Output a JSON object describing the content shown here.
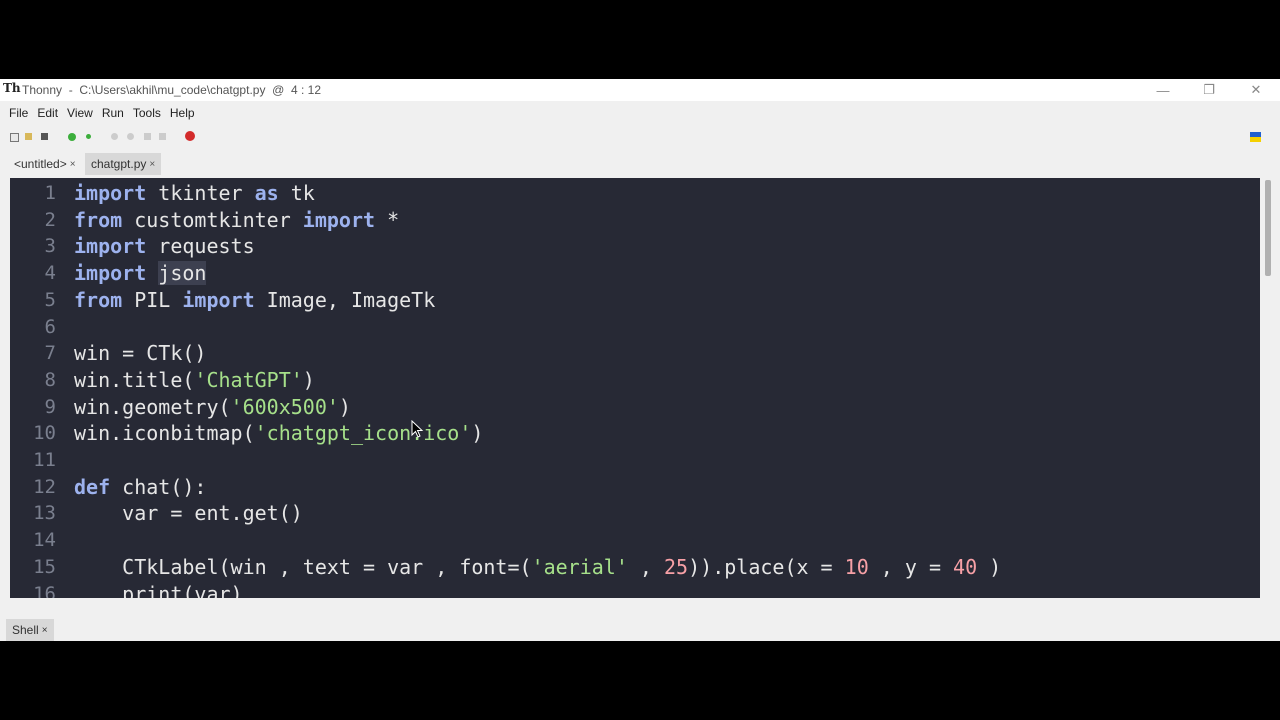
{
  "titlebar": {
    "app_name": "Thonny",
    "path": "  -  C:\\Users\\akhil\\mu_code\\chatgpt.py  @  4 : 12",
    "logo": "Th"
  },
  "menu": [
    "File",
    "Edit",
    "View",
    "Run",
    "Tools",
    "Help"
  ],
  "tabs": [
    {
      "label": "<untitled>",
      "close": "×"
    },
    {
      "label": "chatgpt.py",
      "close": "×"
    }
  ],
  "editor": {
    "lines": [
      {
        "n": "1",
        "parts": [
          [
            "kw",
            "import"
          ],
          [
            "t",
            " tkinter "
          ],
          [
            "kw",
            "as"
          ],
          [
            "t",
            " tk"
          ]
        ]
      },
      {
        "n": "2",
        "parts": [
          [
            "kw",
            "from"
          ],
          [
            "t",
            " customtkinter "
          ],
          [
            "kw",
            "import"
          ],
          [
            "t",
            " *"
          ]
        ]
      },
      {
        "n": "3",
        "parts": [
          [
            "kw",
            "import"
          ],
          [
            "t",
            " requests"
          ]
        ]
      },
      {
        "n": "4",
        "parts": [
          [
            "kw",
            "import"
          ],
          [
            "t",
            " "
          ],
          [
            "hl",
            "json"
          ]
        ]
      },
      {
        "n": "5",
        "parts": [
          [
            "kw",
            "from"
          ],
          [
            "t",
            " PIL "
          ],
          [
            "kw",
            "import"
          ],
          [
            "t",
            " Image, ImageTk"
          ]
        ]
      },
      {
        "n": "6",
        "parts": []
      },
      {
        "n": "7",
        "parts": [
          [
            "t",
            "win = CTk()"
          ]
        ]
      },
      {
        "n": "8",
        "parts": [
          [
            "t",
            "win.title("
          ],
          [
            "str",
            "'ChatGPT'"
          ],
          [
            "t",
            ")"
          ]
        ]
      },
      {
        "n": "9",
        "parts": [
          [
            "t",
            "win.geometry("
          ],
          [
            "str",
            "'600x500'"
          ],
          [
            "t",
            ")"
          ]
        ]
      },
      {
        "n": "10",
        "parts": [
          [
            "t",
            "win.iconbitmap("
          ],
          [
            "str",
            "'chatgpt_icon.ico'"
          ],
          [
            "t",
            ")"
          ]
        ]
      },
      {
        "n": "11",
        "parts": []
      },
      {
        "n": "12",
        "parts": [
          [
            "kw",
            "def"
          ],
          [
            "t",
            " chat():"
          ]
        ]
      },
      {
        "n": "13",
        "parts": [
          [
            "t",
            "    var = ent.get()"
          ]
        ]
      },
      {
        "n": "14",
        "parts": []
      },
      {
        "n": "15",
        "parts": [
          [
            "t",
            "    CTkLabel(win , text = var , font=("
          ],
          [
            "str",
            "'aerial'"
          ],
          [
            "t",
            " , "
          ],
          [
            "num",
            "25"
          ],
          [
            "t",
            ")).place(x = "
          ],
          [
            "num",
            "10"
          ],
          [
            "t",
            " , y = "
          ],
          [
            "num",
            "40"
          ],
          [
            "t",
            " )"
          ]
        ]
      },
      {
        "n": "16",
        "parts": [
          [
            "t",
            "    print(var)"
          ]
        ]
      }
    ]
  },
  "shell_tab": {
    "label": "Shell",
    "close": "×"
  },
  "colors": {
    "editor_bg": "#272935",
    "keyword": "#9db2ee",
    "string": "#a6e08a",
    "number": "#f7a0a6"
  }
}
